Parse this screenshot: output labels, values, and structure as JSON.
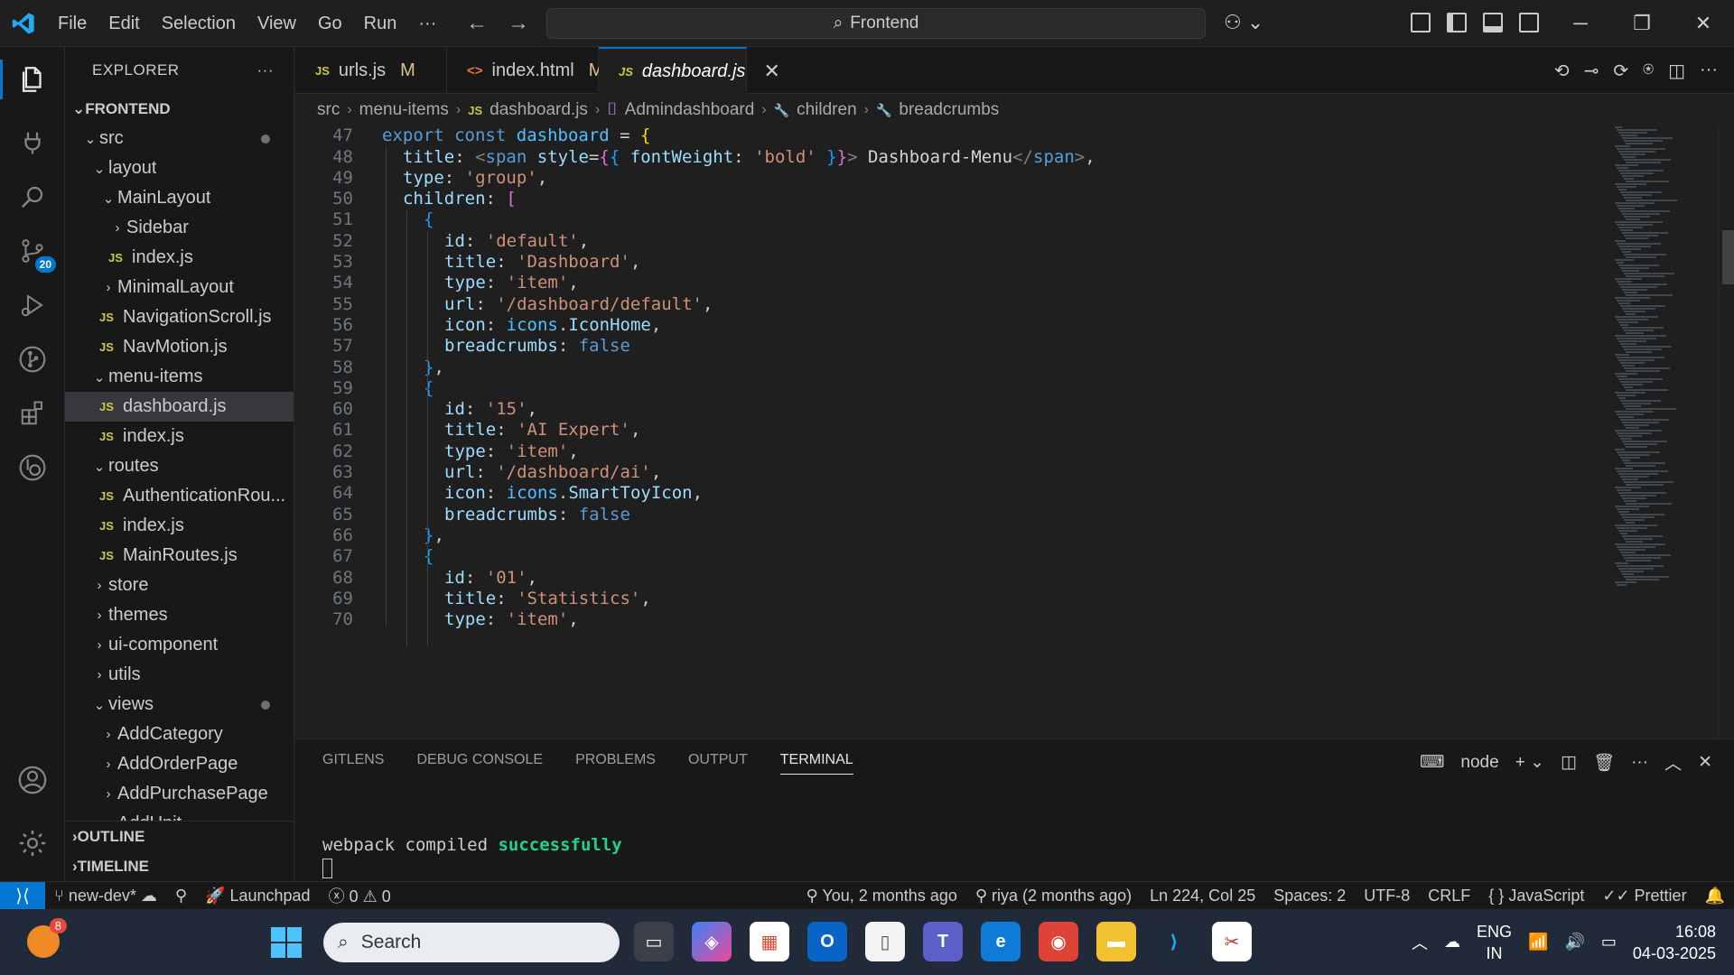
{
  "titlebar": {
    "menu": [
      "File",
      "Edit",
      "Selection",
      "View",
      "Go",
      "Run",
      "···"
    ],
    "search_text": "Frontend"
  },
  "activity": {
    "scm_badge": "20"
  },
  "explorer": {
    "title": "EXPLORER",
    "more": "···",
    "root": "FRONTEND",
    "tree": [
      {
        "depth": 0,
        "kind": "folder-open",
        "name": "src",
        "dot": true
      },
      {
        "depth": 1,
        "kind": "folder-open",
        "name": "layout"
      },
      {
        "depth": 2,
        "kind": "folder-open",
        "name": "MainLayout"
      },
      {
        "depth": 3,
        "kind": "folder",
        "name": "Sidebar"
      },
      {
        "depth": 3,
        "kind": "js",
        "name": "index.js"
      },
      {
        "depth": 2,
        "kind": "folder",
        "name": "MinimalLayout"
      },
      {
        "depth": 2,
        "kind": "js",
        "name": "NavigationScroll.js"
      },
      {
        "depth": 2,
        "kind": "js",
        "name": "NavMotion.js"
      },
      {
        "depth": 1,
        "kind": "folder-open",
        "name": "menu-items"
      },
      {
        "depth": 2,
        "kind": "js",
        "name": "dashboard.js",
        "selected": true
      },
      {
        "depth": 2,
        "kind": "js",
        "name": "index.js"
      },
      {
        "depth": 1,
        "kind": "folder-open",
        "name": "routes"
      },
      {
        "depth": 2,
        "kind": "js",
        "name": "AuthenticationRou..."
      },
      {
        "depth": 2,
        "kind": "js",
        "name": "index.js"
      },
      {
        "depth": 2,
        "kind": "js",
        "name": "MainRoutes.js"
      },
      {
        "depth": 1,
        "kind": "folder",
        "name": "store"
      },
      {
        "depth": 1,
        "kind": "folder",
        "name": "themes"
      },
      {
        "depth": 1,
        "kind": "folder",
        "name": "ui-component"
      },
      {
        "depth": 1,
        "kind": "folder",
        "name": "utils"
      },
      {
        "depth": 1,
        "kind": "folder-open",
        "name": "views",
        "dot": true
      },
      {
        "depth": 2,
        "kind": "folder",
        "name": "AddCategory"
      },
      {
        "depth": 2,
        "kind": "folder",
        "name": "AddOrderPage"
      },
      {
        "depth": 2,
        "kind": "folder",
        "name": "AddPurchasePage"
      },
      {
        "depth": 2,
        "kind": "folder",
        "name": "AddUnit"
      }
    ],
    "outline": "OUTLINE",
    "timeline": "TIMELINE"
  },
  "tabs": [
    {
      "type": "js",
      "icon": "JS",
      "label": "urls.js",
      "mod": "M"
    },
    {
      "type": "html",
      "icon": "<>",
      "label": "index.html",
      "mod": "M"
    },
    {
      "type": "js",
      "icon": "JS",
      "label": "dashboard.js",
      "active": true
    }
  ],
  "breadcrumb": {
    "items": [
      "src",
      "menu-items",
      "dashboard.js",
      "Admindashboard",
      "children",
      "breadcrumbs"
    ],
    "js_icon": "JS"
  },
  "code": {
    "lines": [
      {
        "n": "47",
        "indent": 0,
        "html": "<span class='k'>export</span> <span class='k'>const</span> <span class='v'>dashboard</span> = <span class='b1'>{</span>"
      },
      {
        "n": "48",
        "indent": 1,
        "html": "<span class='p'>title</span>: <span class='t'>&lt;</span><span class='k'>span</span> <span class='at'>style</span>=<span class='b2'>{</span><span class='b3'>{</span> <span class='p'>fontWeight</span>: <span class='s'>'bold'</span> <span class='b3'>}</span><span class='b2'>}</span><span class='t'>&gt;</span><span class='tx'> Dashboard-Menu</span><span class='t'>&lt;/</span><span class='k'>span</span><span class='t'>&gt;</span>,"
      },
      {
        "n": "49",
        "indent": 1,
        "html": "<span class='p'>type</span>: <span class='s'>'group'</span>,"
      },
      {
        "n": "50",
        "indent": 1,
        "html": "<span class='p'>children</span>: <span class='b2'>[</span>"
      },
      {
        "n": "51",
        "indent": 2,
        "html": "<span class='b3'>{</span>"
      },
      {
        "n": "52",
        "indent": 3,
        "html": "<span class='p'>id</span>: <span class='s'>'default'</span>,"
      },
      {
        "n": "53",
        "indent": 3,
        "html": "<span class='p'>title</span>: <span class='s'>'Dashboard'</span>,"
      },
      {
        "n": "54",
        "indent": 3,
        "html": "<span class='p'>type</span>: <span class='s'>'item'</span>,"
      },
      {
        "n": "55",
        "indent": 3,
        "html": "<span class='p'>url</span>: <span class='s'>'/dashboard/default'</span>,"
      },
      {
        "n": "56",
        "indent": 3,
        "html": "<span class='p'>icon</span>: <span class='v'>icons</span>.<span class='p'>IconHome</span>,"
      },
      {
        "n": "57",
        "indent": 3,
        "html": "<span class='p'>breadcrumbs</span>: <span class='k'>false</span>"
      },
      {
        "n": "58",
        "indent": 2,
        "html": "<span class='b3'>}</span>,"
      },
      {
        "n": "59",
        "indent": 2,
        "html": "<span class='b3'>{</span>"
      },
      {
        "n": "60",
        "indent": 3,
        "html": "<span class='p'>id</span>: <span class='s'>'15'</span>,"
      },
      {
        "n": "61",
        "indent": 3,
        "html": "<span class='p'>title</span>: <span class='s'>'AI Expert'</span>,"
      },
      {
        "n": "62",
        "indent": 3,
        "html": "<span class='p'>type</span>: <span class='s'>'item'</span>,"
      },
      {
        "n": "63",
        "indent": 3,
        "html": "<span class='p'>url</span>: <span class='s'>'/dashboard/ai'</span>,"
      },
      {
        "n": "64",
        "indent": 3,
        "html": "<span class='p'>icon</span>: <span class='v'>icons</span>.<span class='p'>SmartToyIcon</span>,"
      },
      {
        "n": "65",
        "indent": 3,
        "html": "<span class='p'>breadcrumbs</span>: <span class='k'>false</span>"
      },
      {
        "n": "66",
        "indent": 2,
        "html": "<span class='b3'>}</span>,"
      },
      {
        "n": "67",
        "indent": 2,
        "html": "<span class='b3'>{</span>"
      },
      {
        "n": "68",
        "indent": 3,
        "html": "<span class='p'>id</span>: <span class='s'>'01'</span>,"
      },
      {
        "n": "69",
        "indent": 3,
        "html": "<span class='p'>title</span>: <span class='s'>'Statistics'</span>,"
      },
      {
        "n": "70",
        "indent": 3,
        "html": "<span class='p'>type</span>: <span class='s'>'item'</span>,"
      }
    ]
  },
  "panel": {
    "tabs": [
      "GITLENS",
      "DEBUG CONSOLE",
      "PROBLEMS",
      "OUTPUT",
      "TERMINAL"
    ],
    "active_tab": "TERMINAL",
    "terminal_name": "node",
    "output_prefix": "webpack compiled ",
    "output_ok": "successfully"
  },
  "status": {
    "branch": "new-dev*",
    "launchpad": "Launchpad",
    "errors": "0",
    "warnings": "0",
    "blame": "You, 2 months ago",
    "author": "riya (2 months ago)",
    "position": "Ln 224, Col 25",
    "spaces": "Spaces: 2",
    "encoding": "UTF-8",
    "eol": "CRLF",
    "language": "JavaScript",
    "formatter": "Prettier"
  },
  "taskbar": {
    "weather_badge": "8",
    "search_text": "Search",
    "lang_1": "ENG",
    "lang_2": "IN",
    "time": "16:08",
    "date": "04-03-2025"
  },
  "colors": {
    "accent": "#0078d4",
    "js_icon": "#cbcb41"
  }
}
